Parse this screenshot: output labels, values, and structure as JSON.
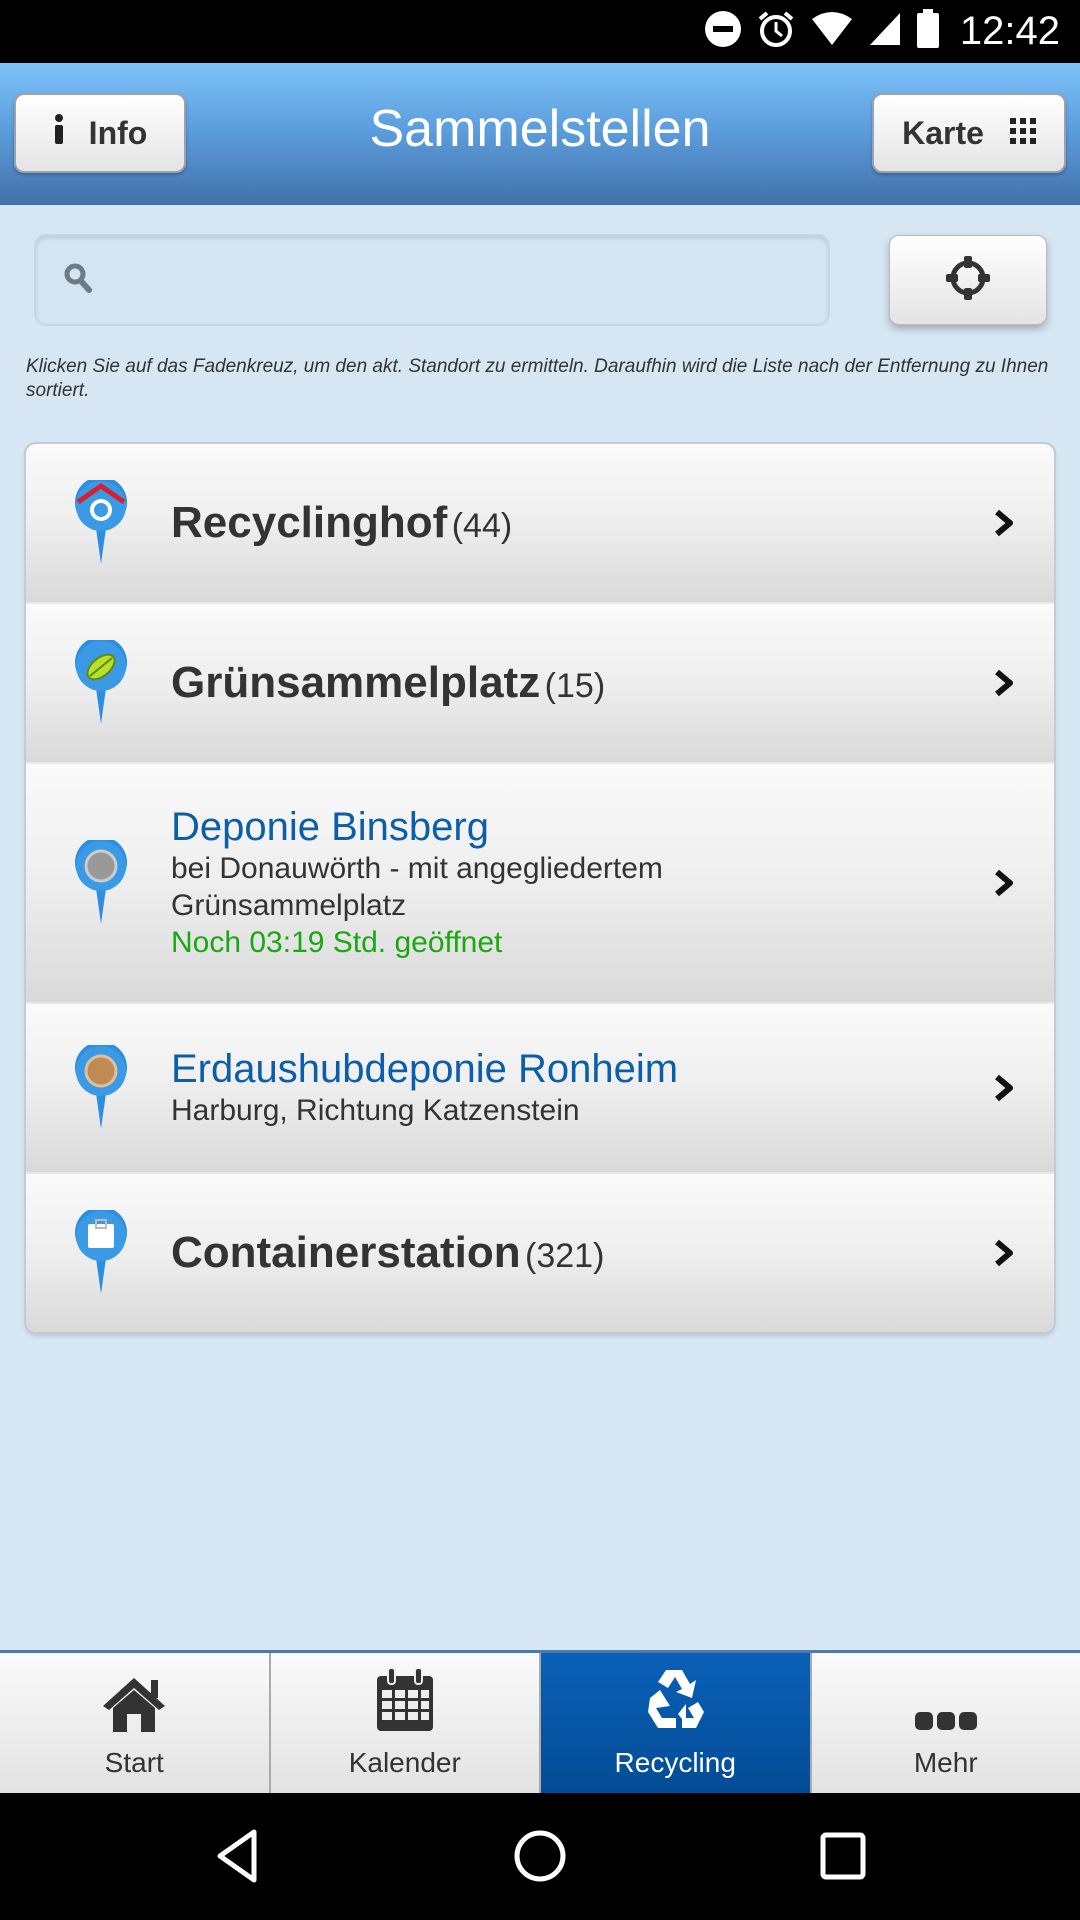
{
  "status_bar": {
    "time": "12:42",
    "icons": [
      "do-not-disturb-icon",
      "alarm-icon",
      "wifi-icon",
      "cell-signal-icon",
      "battery-icon"
    ]
  },
  "header": {
    "title": "Sammelstellen",
    "info_button": {
      "label": "Info",
      "icon": "info-icon"
    },
    "map_button": {
      "label": "Karte",
      "icon": "grid-icon"
    }
  },
  "search": {
    "value": "",
    "placeholder": "",
    "icon": "search-icon",
    "locate_button_icon": "crosshair-icon"
  },
  "hint": "Klicken Sie auf das Fadenkreuz, um den akt. Standort zu ermitteln. Daraufhin wird die Liste nach der Entfernung zu Ihnen sortiert.",
  "list": {
    "items": [
      {
        "title": "Recyclinghof",
        "count": "(44)",
        "icon": "recyclinghof-pin-icon",
        "style": "category"
      },
      {
        "title": "Grünsammelplatz",
        "count": "(15)",
        "icon": "leaf-pin-icon",
        "style": "category"
      },
      {
        "title": "Deponie Binsberg",
        "subtitle": "bei Donauwörth - mit angegliedertem Grünsammelplatz",
        "status": "Noch 03:19 Std. geöffnet",
        "icon": "grey-pin-icon",
        "style": "site"
      },
      {
        "title": "Erdaushubdeponie Ronheim",
        "subtitle": "Harburg, Richtung Katzenstein",
        "icon": "brown-pin-icon",
        "style": "site"
      },
      {
        "title": "Containerstation",
        "count": "(321)",
        "icon": "container-pin-icon",
        "style": "category"
      }
    ]
  },
  "tabbar": {
    "tabs": [
      {
        "label": "Start",
        "icon": "home-icon",
        "active": false
      },
      {
        "label": "Kalender",
        "icon": "calendar-icon",
        "active": false
      },
      {
        "label": "Recycling",
        "icon": "recycle-icon",
        "active": true
      },
      {
        "label": "Mehr",
        "icon": "more-icon",
        "active": false
      }
    ]
  },
  "colors": {
    "header_top": "#7cc2f7",
    "header_bottom": "#4271ab",
    "background": "#d6e6f3",
    "link_blue": "#0d5ea8",
    "open_green": "#1aa812",
    "active_tab": "#0a60b8"
  }
}
